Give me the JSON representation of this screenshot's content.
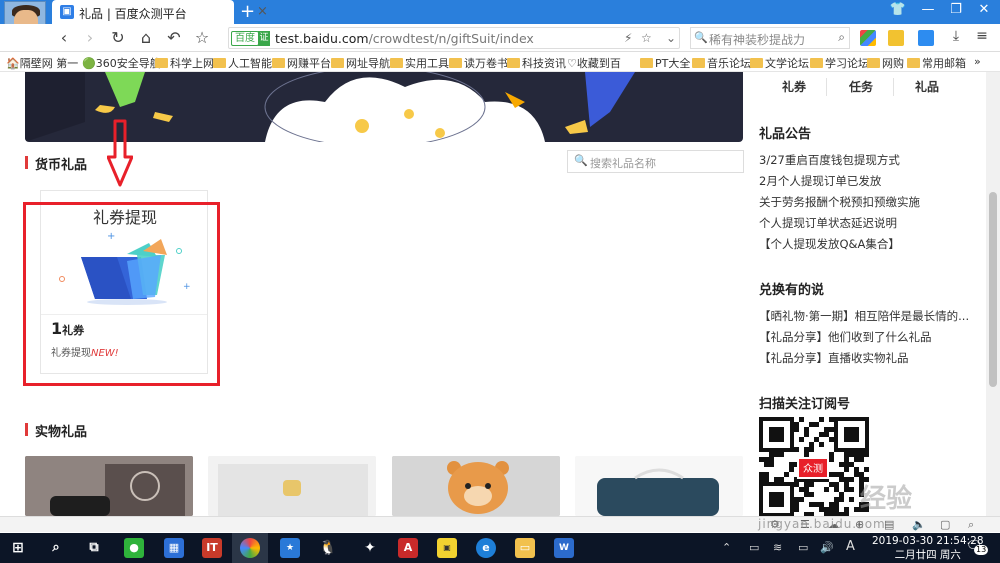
{
  "browser": {
    "tab_title": "礼品 | 百度众测平台",
    "tab_close": "×",
    "new_tab": "+",
    "url_badge": "百度",
    "url_badge_check": "证",
    "url_host": "test.baidu.com",
    "url_path": "/crowdtest/n/giftSuit/index",
    "search_placeholder": "稀有神装秒提战力",
    "bookmarks": [
      "隔壁网 第一",
      "360安全导航",
      "科学上网",
      "人工智能",
      "网赚平台",
      "网址导航",
      "实用工具",
      "读万卷书",
      "科技资讯",
      "收藏到百",
      "PT大全",
      "音乐论坛",
      "文学论坛",
      "学习论坛",
      "网购",
      "常用邮箱",
      "»"
    ]
  },
  "page": {
    "section_currency": "货币礼品",
    "search_gift_placeholder": "搜索礼品名称",
    "card": {
      "title": "礼券提现",
      "amount": "1",
      "unit": "礼券",
      "subtitle": "礼券提现",
      "new_tag": "NEW!"
    },
    "section_physical": "实物礼品"
  },
  "sidebar": {
    "tabs": [
      "礼券",
      "任务",
      "礼品"
    ],
    "announce_title": "礼品公告",
    "announcements": [
      "3/27重启百度钱包提现方式",
      "2月个人提现订单已发放",
      "关于劳务报酬个税预扣预缴实施",
      "个人提现订单状态延迟说明",
      "【个人提现发放Q&A集合】"
    ],
    "share_title": "兑换有的说",
    "shares": [
      "【晒礼物·第一期】相互陪伴是最长情的...",
      "【礼品分享】他们收到了什么礼品",
      "【礼品分享】直播收实物礼品"
    ],
    "qr_title": "扫描关注订阅号",
    "qr_logo": "众测"
  },
  "watermark": {
    "text": "经验",
    "url": "jingyan.baidu.com"
  },
  "taskbar": {
    "time": "2019-03-30 21:54:28",
    "date": "二月廿四 周六",
    "ime": "A",
    "notification_count": "13"
  },
  "colors": {
    "accent_red": "#e8202a",
    "section_bar": "#e03a3a",
    "tab_blue": "#2a7fdc",
    "taskbar": "#0c1526"
  }
}
